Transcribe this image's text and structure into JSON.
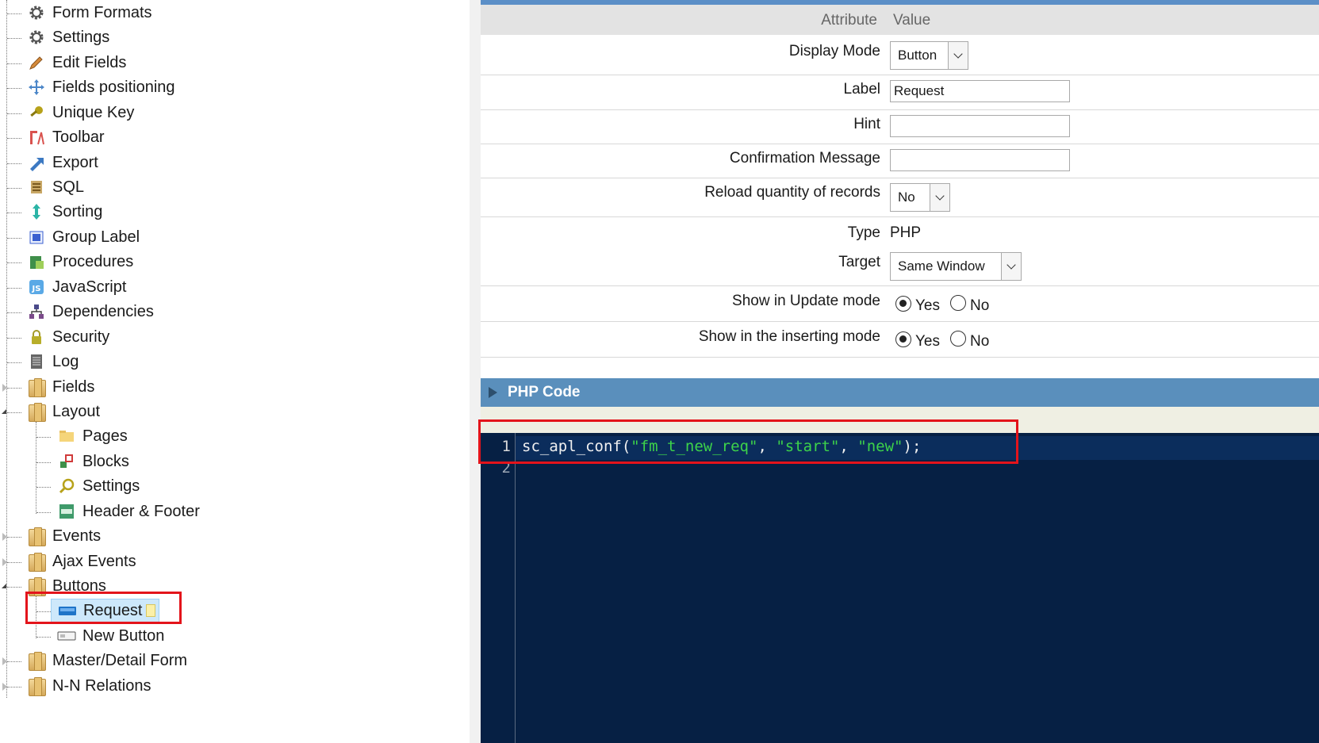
{
  "tree": {
    "items": [
      {
        "label": "Form Formats",
        "icon": "gear-icon"
      },
      {
        "label": "Settings",
        "icon": "gear-icon"
      },
      {
        "label": "Edit Fields",
        "icon": "pencil-icon"
      },
      {
        "label": "Fields positioning",
        "icon": "move-arrows-icon"
      },
      {
        "label": "Unique Key",
        "icon": "key-icon"
      },
      {
        "label": "Toolbar",
        "icon": "toolbar-icon"
      },
      {
        "label": "Export",
        "icon": "export-arrow-icon"
      },
      {
        "label": "SQL",
        "icon": "sql-icon"
      },
      {
        "label": "Sorting",
        "icon": "sort-arrows-icon"
      },
      {
        "label": "Group Label",
        "icon": "group-label-icon"
      },
      {
        "label": "Procedures",
        "icon": "procedures-icon"
      },
      {
        "label": "JavaScript",
        "icon": "javascript-icon"
      },
      {
        "label": "Dependencies",
        "icon": "dependencies-icon"
      },
      {
        "label": "Security",
        "icon": "lock-icon"
      },
      {
        "label": "Log",
        "icon": "log-icon"
      },
      {
        "label": "Fields",
        "icon": "folder-icon"
      },
      {
        "label": "Layout",
        "icon": "folder-icon"
      },
      {
        "label": "Pages",
        "icon": "pages-icon"
      },
      {
        "label": "Blocks",
        "icon": "blocks-icon"
      },
      {
        "label": "Settings",
        "icon": "magnifier-icon"
      },
      {
        "label": "Header & Footer",
        "icon": "header-footer-icon"
      },
      {
        "label": "Events",
        "icon": "folder-icon"
      },
      {
        "label": "Ajax Events",
        "icon": "folder-icon"
      },
      {
        "label": "Buttons",
        "icon": "folder-icon"
      },
      {
        "label": "Request",
        "icon": "button-icon"
      },
      {
        "label": "New Button",
        "icon": "button-outline-icon"
      },
      {
        "label": "Master/Detail Form",
        "icon": "folder-icon"
      },
      {
        "label": "N-N Relations",
        "icon": "folder-icon"
      }
    ],
    "selected": "Request"
  },
  "attributes": {
    "header_attribute": "Attribute",
    "header_value": "Value",
    "display_mode": {
      "label": "Display Mode",
      "value": "Button"
    },
    "label_field": {
      "label": "Label",
      "value": "Request"
    },
    "hint": {
      "label": "Hint",
      "value": ""
    },
    "confirmation": {
      "label": "Confirmation Message",
      "value": ""
    },
    "reload": {
      "label": "Reload quantity of records",
      "value": "No"
    },
    "type": {
      "label": "Type",
      "value": "PHP"
    },
    "target": {
      "label": "Target",
      "value": "Same Window"
    },
    "show_update": {
      "label": "Show in Update mode",
      "yes": "Yes",
      "no": "No",
      "selected": "Yes"
    },
    "show_insert": {
      "label": "Show in the inserting mode",
      "yes": "Yes",
      "no": "No",
      "selected": "Yes"
    }
  },
  "php_code": {
    "title": "PHP Code",
    "line_numbers": [
      "1",
      "2"
    ],
    "tokens": {
      "func": "sc_apl_conf(",
      "arg1": "\"fm_t_new_req\"",
      "sep1": ", ",
      "arg2": "\"start\"",
      "sep2": ", ",
      "arg3": "\"new\"",
      "end": ");"
    }
  },
  "colors": {
    "highlight_red": "#e3141b",
    "bar_blue": "#5a8fbc",
    "editor_bg": "#062044",
    "string_green": "#3dd34a"
  }
}
